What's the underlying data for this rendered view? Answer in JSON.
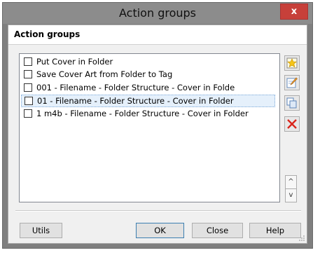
{
  "window": {
    "title": "Action groups",
    "close_label": "x"
  },
  "header": {
    "label": "Action groups"
  },
  "list": {
    "items": [
      {
        "label": "Put Cover in Folder",
        "checked": false,
        "selected": false
      },
      {
        "label": "Save Cover Art from Folder to Tag",
        "checked": false,
        "selected": false
      },
      {
        "label": "001 - Filename - Folder Structure - Cover in Folde",
        "checked": false,
        "selected": false
      },
      {
        "label": "01 - Filename - Folder Structure - Cover in Folder",
        "checked": false,
        "selected": true
      },
      {
        "label": "1 m4b - Filename - Folder Structure - Cover in Folder",
        "checked": false,
        "selected": false
      }
    ]
  },
  "side_buttons": {
    "new": "new-star-icon",
    "edit": "edit-pencil-icon",
    "duplicate": "duplicate-icon",
    "delete": "delete-x-icon",
    "up": "^",
    "down": "v"
  },
  "footer": {
    "utils_label": "Utils",
    "ok_label": "OK",
    "close_label": "Close",
    "help_label": "Help"
  },
  "colors": {
    "close_button": "#c7403a",
    "selection_fill": "#e5f0fb",
    "delete_red": "#d9261c"
  }
}
